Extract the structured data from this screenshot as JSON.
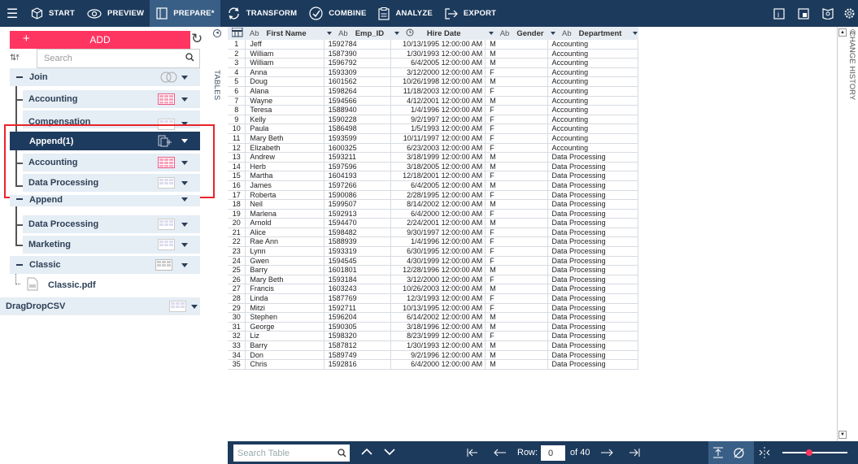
{
  "topbar": {
    "nav": [
      {
        "label": "START",
        "icon": "cube-icon"
      },
      {
        "label": "PREVIEW",
        "icon": "eye-icon"
      },
      {
        "label": "PREPARE*",
        "icon": "table-icon",
        "active": true
      },
      {
        "label": "TRANSFORM",
        "icon": "transform-icon"
      },
      {
        "label": "COMBINE",
        "icon": "combine-icon"
      },
      {
        "label": "ANALYZE",
        "icon": "clipboard-icon"
      },
      {
        "label": "EXPORT",
        "icon": "export-icon"
      }
    ]
  },
  "left": {
    "add_label": "ADD",
    "search_placeholder": "Search",
    "tables_label": "TABLES",
    "tree": {
      "join": "Join",
      "accounting1": "Accounting",
      "compensation": "Compensation",
      "append1": "Append(1)",
      "accounting2": "Accounting",
      "dataproc1": "Data Processing",
      "append2": "Append",
      "dataproc2": "Data Processing",
      "marketing": "Marketing",
      "classic": "Classic",
      "classicpdf": "Classic.pdf",
      "dragdrop": "DragDropCSV"
    }
  },
  "grid": {
    "columns": [
      {
        "type": "Ab",
        "name": "First Name"
      },
      {
        "type": "Ab",
        "name": "Emp_ID"
      },
      {
        "type": "clock",
        "name": "Hire Date"
      },
      {
        "type": "Ab",
        "name": "Gender"
      },
      {
        "type": "Ab",
        "name": "Department"
      }
    ],
    "rows": [
      [
        "1",
        "Jeff",
        "1592784",
        "10/13/1995 12:00:00 AM",
        "M",
        "Accounting"
      ],
      [
        "2",
        "William",
        "1587390",
        "1/30/1993 12:00:00 AM",
        "M",
        "Accounting"
      ],
      [
        "3",
        "William",
        "1596792",
        "6/4/2005 12:00:00 AM",
        "M",
        "Accounting"
      ],
      [
        "4",
        "Anna",
        "1593309",
        "3/12/2000 12:00:00 AM",
        "F",
        "Accounting"
      ],
      [
        "5",
        "Doug",
        "1601562",
        "10/26/1998 12:00:00 AM",
        "M",
        "Accounting"
      ],
      [
        "6",
        "Alana",
        "1598264",
        "11/18/2003 12:00:00 AM",
        "F",
        "Accounting"
      ],
      [
        "7",
        "Wayne",
        "1594566",
        "4/12/2001 12:00:00 AM",
        "M",
        "Accounting"
      ],
      [
        "8",
        "Teresa",
        "1588940",
        "1/4/1996 12:00:00 AM",
        "F",
        "Accounting"
      ],
      [
        "9",
        "Kelly",
        "1590228",
        "9/2/1997 12:00:00 AM",
        "F",
        "Accounting"
      ],
      [
        "10",
        "Paula",
        "1586498",
        "1/5/1993 12:00:00 AM",
        "F",
        "Accounting"
      ],
      [
        "11",
        "Mary Beth",
        "1593599",
        "10/11/1997 12:00:00 AM",
        "F",
        "Accounting"
      ],
      [
        "12",
        "Elizabeth",
        "1600325",
        "6/23/2003 12:00:00 AM",
        "F",
        "Accounting"
      ],
      [
        "13",
        "Andrew",
        "1593211",
        "3/18/1999 12:00:00 AM",
        "M",
        "Data Processing"
      ],
      [
        "14",
        "Herb",
        "1597596",
        "3/18/2005 12:00:00 AM",
        "M",
        "Data Processing"
      ],
      [
        "15",
        "Martha",
        "1604193",
        "12/18/2001 12:00:00 AM",
        "F",
        "Data Processing"
      ],
      [
        "16",
        "James",
        "1597266",
        "6/4/2005 12:00:00 AM",
        "M",
        "Data Processing"
      ],
      [
        "17",
        "Roberta",
        "1590086",
        "2/28/1995 12:00:00 AM",
        "F",
        "Data Processing"
      ],
      [
        "18",
        "Neil",
        "1599507",
        "8/14/2002 12:00:00 AM",
        "M",
        "Data Processing"
      ],
      [
        "19",
        "Marlena",
        "1592913",
        "6/4/2000 12:00:00 AM",
        "F",
        "Data Processing"
      ],
      [
        "20",
        "Arnold",
        "1594470",
        "2/24/2001 12:00:00 AM",
        "M",
        "Data Processing"
      ],
      [
        "21",
        "Alice",
        "1598482",
        "9/30/1997 12:00:00 AM",
        "F",
        "Data Processing"
      ],
      [
        "22",
        "Rae Ann",
        "1588939",
        "1/4/1996 12:00:00 AM",
        "F",
        "Data Processing"
      ],
      [
        "23",
        "Lynn",
        "1593319",
        "6/30/1995 12:00:00 AM",
        "F",
        "Data Processing"
      ],
      [
        "24",
        "Gwen",
        "1594545",
        "4/30/1999 12:00:00 AM",
        "F",
        "Data Processing"
      ],
      [
        "25",
        "Barry",
        "1601801",
        "12/28/1996 12:00:00 AM",
        "M",
        "Data Processing"
      ],
      [
        "26",
        "Mary Beth",
        "1593184",
        "3/12/2000 12:00:00 AM",
        "F",
        "Data Processing"
      ],
      [
        "27",
        "Francis",
        "1603243",
        "10/26/2003 12:00:00 AM",
        "M",
        "Data Processing"
      ],
      [
        "28",
        "Linda",
        "1587769",
        "12/3/1993 12:00:00 AM",
        "F",
        "Data Processing"
      ],
      [
        "29",
        "Mitzi",
        "1592711",
        "10/13/1995 12:00:00 AM",
        "F",
        "Data Processing"
      ],
      [
        "30",
        "Stephen",
        "1596204",
        "6/14/2002 12:00:00 AM",
        "M",
        "Data Processing"
      ],
      [
        "31",
        "George",
        "1590305",
        "3/18/1996 12:00:00 AM",
        "M",
        "Data Processing"
      ],
      [
        "32",
        "Liz",
        "1598320",
        "8/23/1999 12:00:00 AM",
        "F",
        "Data Processing"
      ],
      [
        "33",
        "Barry",
        "1587812",
        "1/30/1993 12:00:00 AM",
        "M",
        "Data Processing"
      ],
      [
        "34",
        "Don",
        "1589749",
        "9/2/1996 12:00:00 AM",
        "M",
        "Data Processing"
      ],
      [
        "35",
        "Chris",
        "1592816",
        "6/4/2000 12:00:00 AM",
        "M",
        "Data Processing"
      ]
    ]
  },
  "bottom": {
    "search_placeholder": "Search Table",
    "row_label": "Row:",
    "row_value": "0",
    "of_label": "of 40"
  },
  "right": {
    "label": "CHANGE HISTORY"
  },
  "colors": {
    "nav": "#1c3a5c",
    "accent": "#ff3561",
    "highlight": "#e8232a"
  }
}
